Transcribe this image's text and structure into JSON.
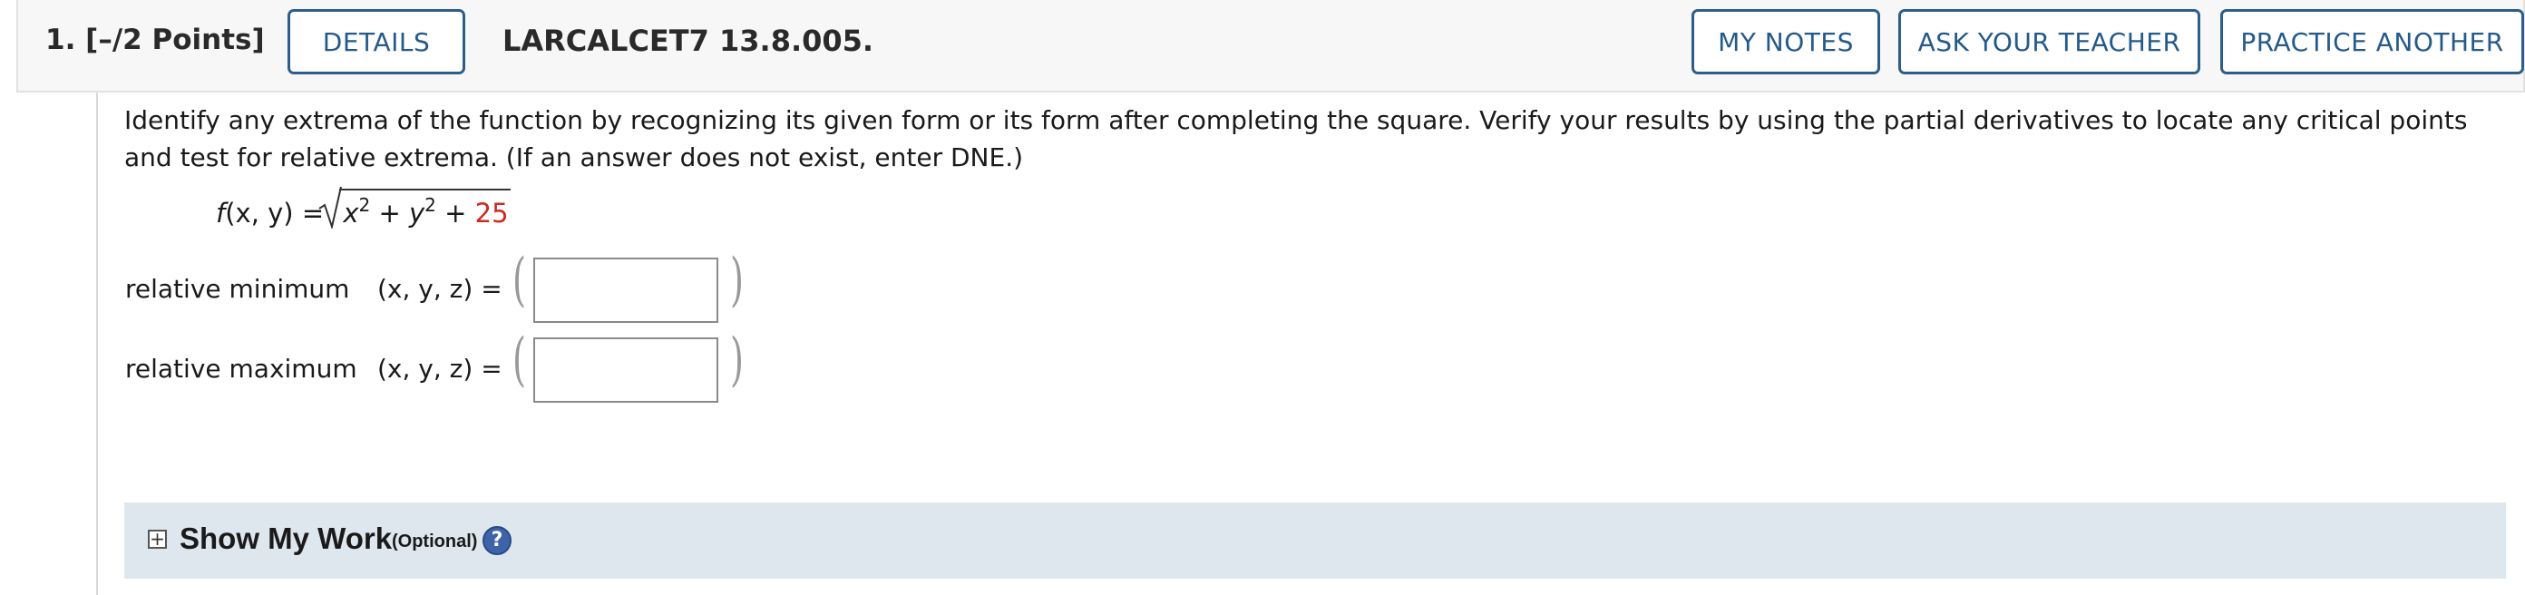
{
  "header": {
    "question_number": "1.",
    "points": "[–/2 Points]",
    "details_label": "DETAILS",
    "assignment_id": "LARCALCET7 13.8.005.",
    "my_notes_label": "MY NOTES",
    "ask_teacher_label": "ASK YOUR TEACHER",
    "practice_another_label": "PRACTICE ANOTHER"
  },
  "question": {
    "prompt": "Identify any extrema of the function by recognizing its given form or its form after completing the square. Verify your results by using the partial derivatives to locate any critical points and test for relative extrema. (If an answer does not exist, enter DNE.)",
    "function_lhs": "f(x, y) =",
    "x_term": "x",
    "y_term": "y",
    "exponent": "2",
    "plus": "+",
    "constant": "25"
  },
  "answers": [
    {
      "label": "relative minimum",
      "coords": "(x, y, z)  =",
      "value": ""
    },
    {
      "label": "relative maximum",
      "coords": "(x, y, z)  =",
      "value": ""
    }
  ],
  "show_work": {
    "expand_icon": "+",
    "title": "Show My Work",
    "optional": "(Optional)",
    "help_icon": "?"
  },
  "colors": {
    "button_border": "#2d5d8a",
    "button_text": "#245a8a",
    "highlight_red": "#cc2a1f",
    "work_panel_bg": "#dfe7ee",
    "help_icon_bg": "#3d63a8"
  }
}
